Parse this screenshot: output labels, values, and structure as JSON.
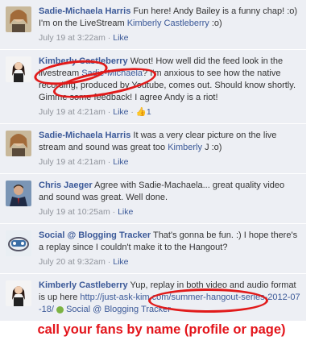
{
  "comments": [
    {
      "author": "Sadie-Michaela Harris",
      "text": "Fun here! Andy Bailey is a funny chap! :o)",
      "text2": "I'm on the LiveStream ",
      "mention": "Kimberly Castleberry",
      "text3": " :o)",
      "timestamp": "July 19 at 3:22am",
      "like": "Like"
    },
    {
      "author": "Kimberly Castleberry",
      "text": "Woot! How well did the feed look in the livestream ",
      "mention": "Sadie-Michaela",
      "text2": "? I'm anxious to see how the native recording, produced by Youtube, comes out. Should know shortly. Gimme some feedback! I agree Andy is a riot!",
      "timestamp": "July 19 at 4:21am",
      "like": "Like",
      "like_count": "1"
    },
    {
      "author": "Sadie-Michaela Harris",
      "text": "It was a very clear picture on the live stream and sound was great too ",
      "mention": "Kimberly",
      "text2": " J :o)",
      "timestamp": "July 19 at 4:21am",
      "like": "Like"
    },
    {
      "author": "Chris Jaeger",
      "text": "Agree with Sadie-Machaela... great quality video and sound was great. Well done.",
      "timestamp": "July 19 at 10:25am",
      "like": "Like"
    },
    {
      "author": "Social @ Blogging Tracker",
      "text": "That's gonna be fun. :) I hope there's a replay since I couldn't make it to the Hangout?",
      "timestamp": "July 20 at 9:32am",
      "like": "Like"
    },
    {
      "author": "Kimberly Castleberry",
      "text": "Yup, replay in both video and audio format is up here ",
      "url": "http://just-ask-kim.com/summer-hangout-series-2012-07-18/",
      "mention": "Social @ Blogging Tracker"
    }
  ],
  "callout": "call your fans by name (profile or page)",
  "colors": {
    "accent": "#3b5998",
    "comment_bg": "#edeff4",
    "callout": "#e3141b"
  }
}
